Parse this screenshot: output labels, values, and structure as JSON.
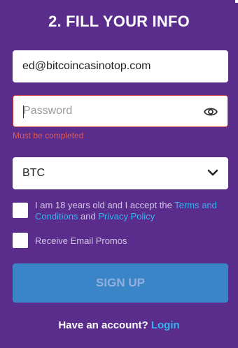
{
  "heading": "2. FILL YOUR INFO",
  "email": {
    "value": "ed@bitcoincasinotop.com"
  },
  "password": {
    "placeholder": "Password",
    "error": "Must be completed"
  },
  "currency": {
    "selected": "BTC"
  },
  "terms": {
    "text": "I am 18 years old and I accept the ",
    "terms_link": "Terms and Conditions",
    "and_text": " and ",
    "privacy_link": "Privacy Policy"
  },
  "promo": {
    "label": "Receive Email Promos"
  },
  "signup": {
    "label": "SIGN UP"
  },
  "account": {
    "prompt": "Have an account?",
    "login_link": "Login"
  },
  "colors": {
    "background": "#5a2d8c",
    "accent": "#33b4f0",
    "error": "#e05a55",
    "button": "#3a84c8"
  }
}
